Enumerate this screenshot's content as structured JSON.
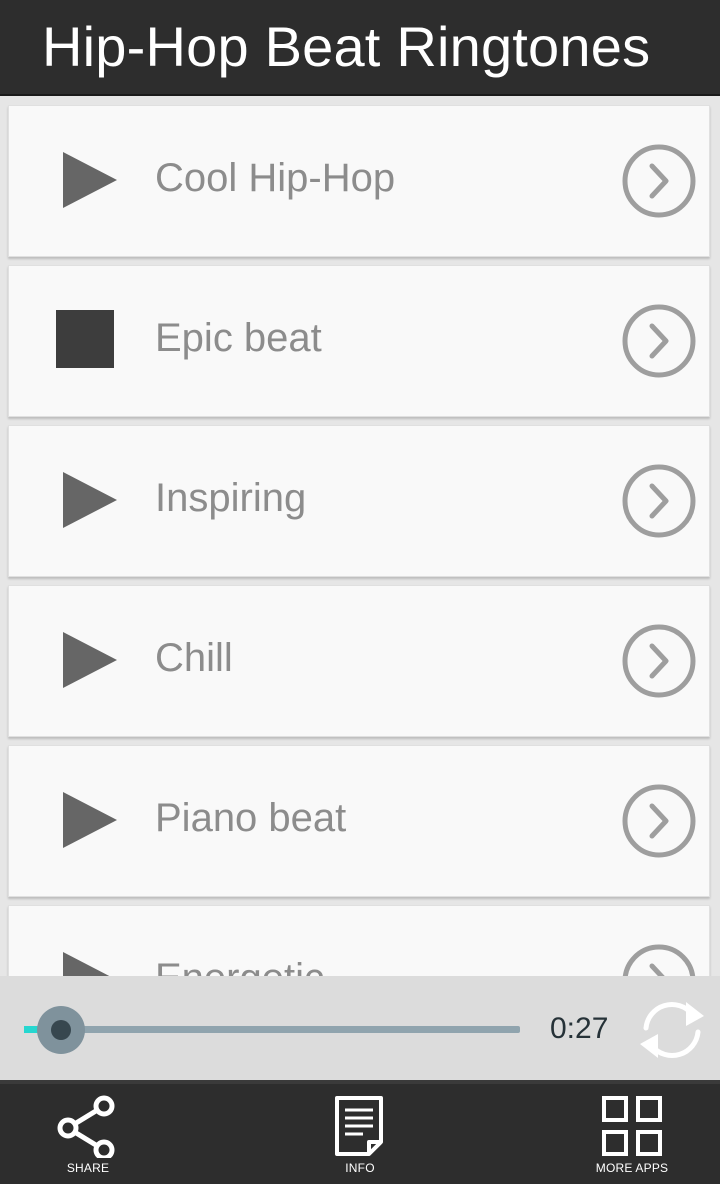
{
  "header": {
    "title": "Hip-Hop Beat Ringtones"
  },
  "ringtones": [
    {
      "label": "Cool Hip-Hop",
      "state": "play-icon"
    },
    {
      "label": "Epic beat",
      "state": "stop-icon"
    },
    {
      "label": "Inspiring",
      "state": "play-icon"
    },
    {
      "label": "Chill",
      "state": "play-icon"
    },
    {
      "label": "Piano beat",
      "state": "play-icon"
    },
    {
      "label": "Energetic",
      "state": "play-icon"
    }
  ],
  "player": {
    "time": "0:27",
    "progress": 0.03
  },
  "nav": [
    {
      "label": "SHARE",
      "icon": "share-icon"
    },
    {
      "label": "INFO",
      "icon": "info-document-icon"
    },
    {
      "label": "MORE APPS",
      "icon": "grid-icon"
    }
  ],
  "colors": {
    "accent": "#26d7d0",
    "bar": "#2d2d2d",
    "icon": "#666666",
    "chevron": "#9e9e9e"
  }
}
